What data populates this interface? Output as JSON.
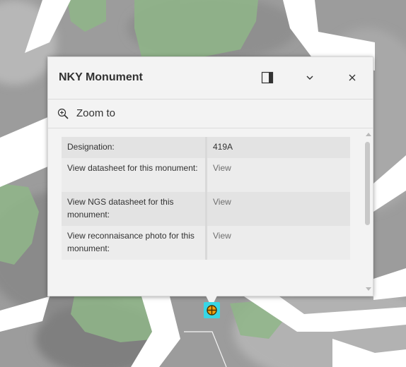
{
  "popup": {
    "title": "NKY Monument",
    "actions": {
      "zoom_to": "Zoom to"
    },
    "fields": [
      {
        "label": "Designation:",
        "value": "419A"
      },
      {
        "label": "View datasheet for this monument:",
        "value": "View"
      },
      {
        "label": "View NGS datasheet for this monument:",
        "value": "View"
      },
      {
        "label": "View reconnaisance photo for this monument:",
        "value": "View"
      }
    ]
  },
  "colors": {
    "road": "#ffffff",
    "terrain": "#9a9a9a",
    "vegetation": "#8fb688",
    "marker_highlight": "#38d6e6",
    "marker_fill": "#f0a010"
  },
  "icons": [
    "dock-icon",
    "chevron-down-icon",
    "close-icon",
    "zoom-in-icon",
    "monument-marker-icon"
  ]
}
